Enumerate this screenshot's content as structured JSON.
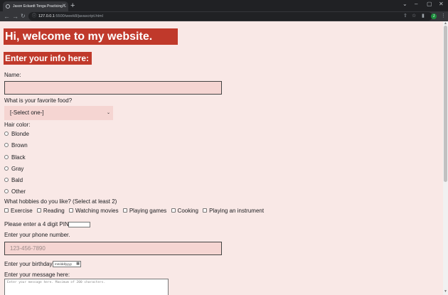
{
  "browser": {
    "tab_title": "Jason Eckardt Tonga Practicing ...",
    "new_tab": "+",
    "url_host": "127.0.0.1",
    "url_path": ":5500/week8/javascript.html",
    "minimize": "⌄",
    "minimize2": "–",
    "maximize": "▢",
    "close": "✕",
    "avatar_letter": "J"
  },
  "page": {
    "heading": "Hi, welcome to my website.",
    "subheading": "Enter your info here:",
    "name_label": "Name:",
    "food_label": "What is your favorite food?",
    "food_select": "[-Select one-]",
    "hair_label": "Hair color:",
    "hair_options": [
      "Blonde",
      "Brown",
      "Black",
      "Gray",
      "Bald",
      "Other"
    ],
    "hobbies_label": "What hobbies do you like? (Select at least 2)",
    "hobbies": [
      "Exercise",
      "Reading",
      "Watching movies",
      "Playing games",
      "Cooking",
      "Playing an instrument"
    ],
    "pin_label": "Please enter a 4 digit PIN.",
    "phone_label": "Enter your phone number.",
    "phone_placeholder": "123-456-7890",
    "birthday_label": "Enter your birthday:",
    "birthday_placeholder": "mm/dd/yyyy",
    "message_label": "Enter your message here:",
    "message_placeholder": "Enter your message here. Maximum of 200 characters."
  },
  "colors": {
    "page_background": "#f9e8e6",
    "heading_background": "#c0392b",
    "input_background": "#f5d5d2"
  }
}
